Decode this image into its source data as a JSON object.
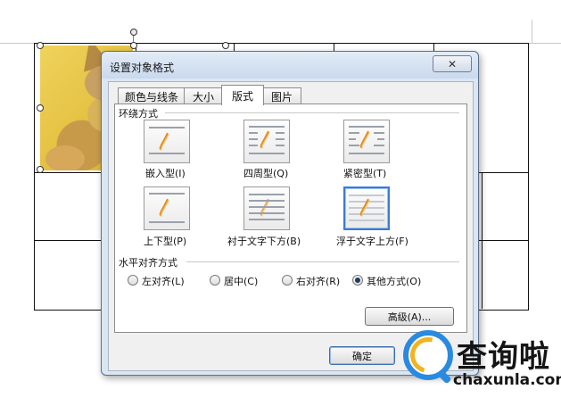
{
  "dialog": {
    "title": "设置对象格式",
    "close_label": "✕",
    "tabs": [
      {
        "label": "颜色与线条",
        "active": false
      },
      {
        "label": "大小",
        "active": false
      },
      {
        "label": "版式",
        "active": true
      },
      {
        "label": "图片",
        "active": false
      }
    ],
    "wrap_group_label": "环绕方式",
    "wrap_options": [
      {
        "label": "嵌入型(I)",
        "icon": "wrap-inline-icon",
        "selected": false
      },
      {
        "label": "四周型(Q)",
        "icon": "wrap-square-icon",
        "selected": false
      },
      {
        "label": "紧密型(T)",
        "icon": "wrap-tight-icon",
        "selected": false
      },
      {
        "label": "上下型(P)",
        "icon": "wrap-top-bottom-icon",
        "selected": false
      },
      {
        "label": "衬于文字下方(B)",
        "icon": "wrap-behind-text-icon",
        "selected": false
      },
      {
        "label": "浮于文字上方(F)",
        "icon": "wrap-in-front-icon",
        "selected": true
      }
    ],
    "align_group_label": "水平对齐方式",
    "align_options": [
      {
        "label": "左对齐(L)",
        "checked": false
      },
      {
        "label": "居中(C)",
        "checked": false
      },
      {
        "label": "右对齐(R)",
        "checked": false
      },
      {
        "label": "其他方式(O)",
        "checked": true
      }
    ],
    "advanced_label": "高级(A)...",
    "ok_label": "确定"
  },
  "watermark": {
    "brand": "查询啦",
    "domain": "chaxunla.com",
    "colors": {
      "blue": "#2a8ae0",
      "orange": "#f3b21f"
    }
  },
  "colors": {
    "dialog_frame": "#dbe6f3",
    "selected_border": "#3a7bd5",
    "photo_background": "#e7c547"
  }
}
